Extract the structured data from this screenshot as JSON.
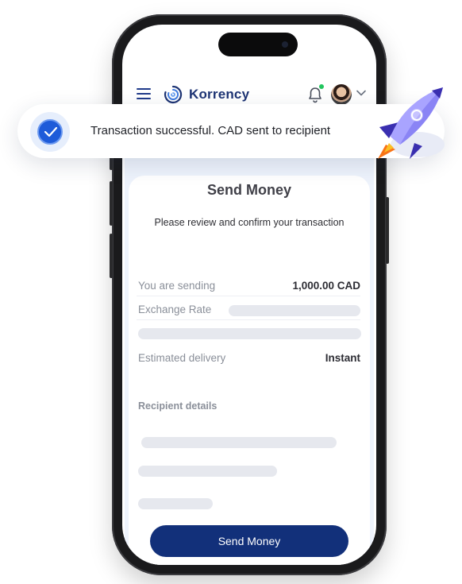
{
  "app": {
    "brand": "Korrency"
  },
  "toast": {
    "message": "Transaction successful. CAD sent to recipient"
  },
  "card": {
    "title": "Send Money",
    "subtitle": "Please review and confirm your transaction",
    "rows": [
      {
        "label": "You are sending",
        "value": "1,000.00 CAD"
      },
      {
        "label": "Exchange Rate",
        "value": ""
      },
      {
        "label": "Estimated delivery",
        "value": "Instant"
      }
    ],
    "recipient_heading": "Recipient details",
    "send_button": "Send Money"
  },
  "colors": {
    "primary": "#12307a",
    "brand_text": "#1e3474",
    "accent_blue": "#1e5bd9",
    "notification_dot": "#22c55e",
    "skeleton": "#e6e8ee"
  },
  "icons": [
    "menu-icon",
    "korrency-logo-icon",
    "bell-icon",
    "chevron-down-icon",
    "check-icon",
    "rocket-icon"
  ]
}
